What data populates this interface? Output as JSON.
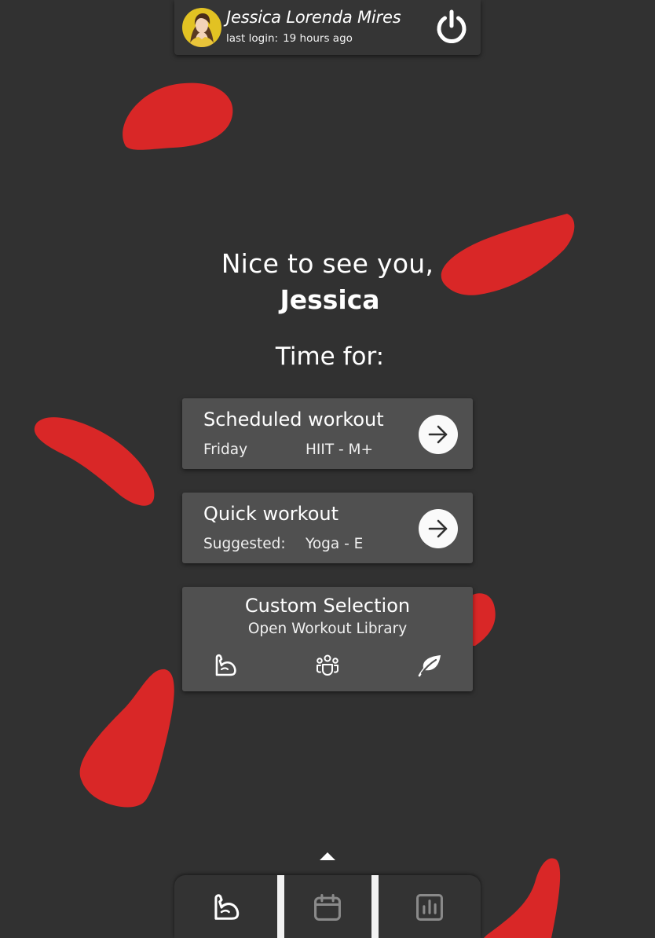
{
  "header": {
    "user_name": "Jessica Lorenda Mires",
    "last_login_label": "last login:",
    "last_login_value": "19 hours ago",
    "avatar_icon": "user-avatar-photo",
    "logout_icon": "power-icon"
  },
  "greeting": {
    "line1": "Nice to see you,",
    "name": "Jessica"
  },
  "time_for_label": "Time for:",
  "scheduled_workout": {
    "title": "Scheduled workout",
    "day": "Friday",
    "workout": "HIIT - M+",
    "action_icon": "arrow-right-icon"
  },
  "quick_workout": {
    "title": "Quick workout",
    "suggested_label": "Suggested:",
    "workout": "Yoga - E",
    "action_icon": "arrow-right-icon"
  },
  "custom_selection": {
    "title": "Custom Selection",
    "subtitle": "Open Workout Library",
    "categories": [
      "strength-arm-icon",
      "group-class-icon",
      "wellness-leaf-icon"
    ]
  },
  "bottom_nav": {
    "toggle_icon": "caret-up-icon",
    "items": [
      "workout-arm-icon",
      "calendar-icon",
      "stats-chart-icon"
    ],
    "active_item": "workout-arm-icon"
  },
  "colors": {
    "background": "#313131",
    "card": "#505050",
    "accent_red": "#d92727",
    "text": "#ffffff",
    "inactive_icon": "#8a8a8a"
  }
}
